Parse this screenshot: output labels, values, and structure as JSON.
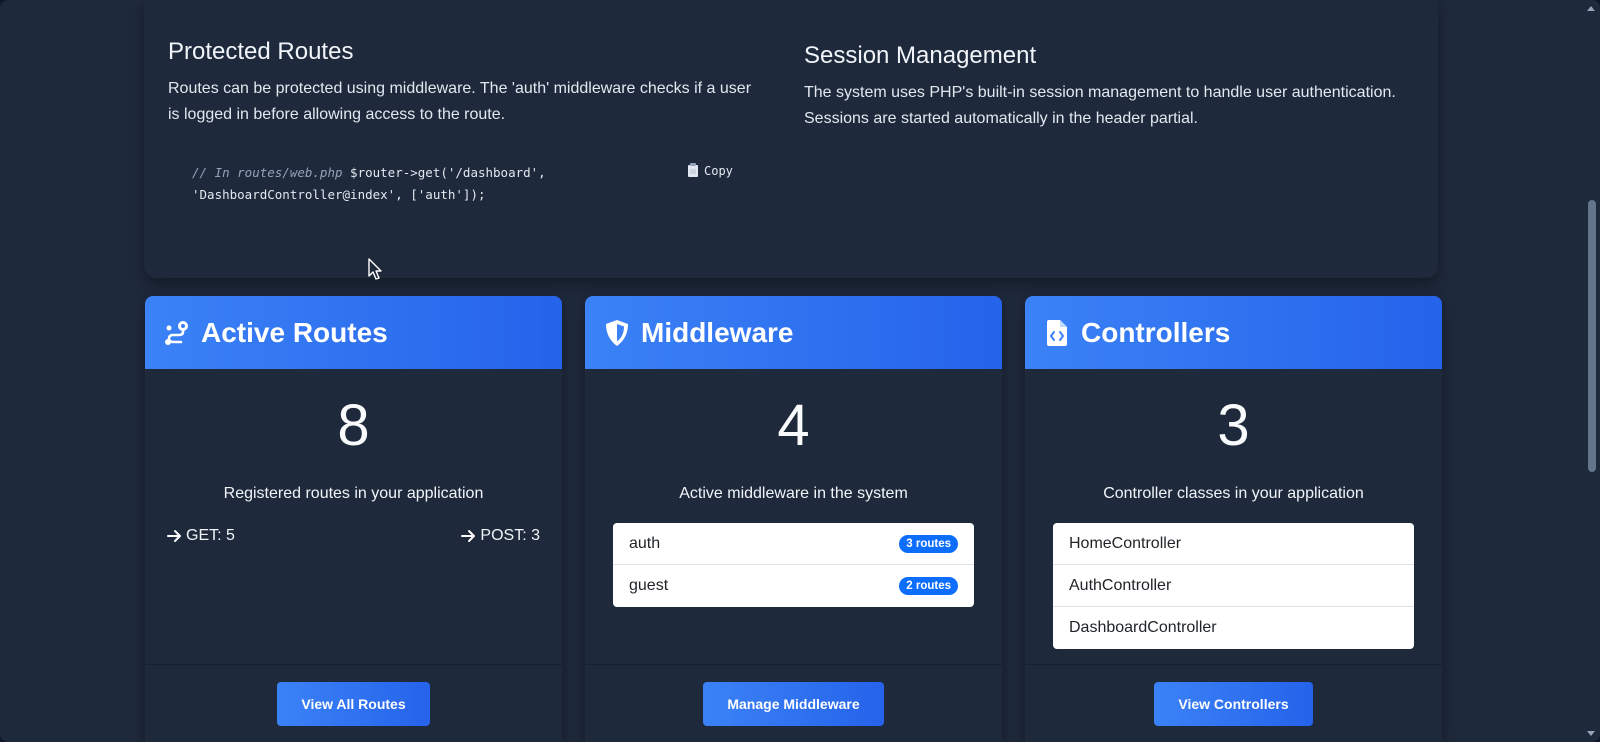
{
  "info": {
    "protected": {
      "title": "Protected Routes",
      "text": "Routes can be protected using middleware. The 'auth' middleware checks if a user is logged in before allowing access to the route.",
      "code_comment": "// In routes/web.php",
      "code_rest": " $router->get('/dashboard', 'DashboardController@index', ['auth']);",
      "copy_label": "Copy"
    },
    "session": {
      "title": "Session Management",
      "text": "The system uses PHP's built-in session management to handle user authentication. Sessions are started automatically in the header partial."
    }
  },
  "cards": {
    "routes": {
      "title": "Active Routes",
      "count": "8",
      "desc": "Registered routes in your application",
      "get_label": "GET: 5",
      "post_label": "POST: 3",
      "button": "View All Routes"
    },
    "middleware": {
      "title": "Middleware",
      "count": "4",
      "desc": "Active middleware in the system",
      "items": [
        {
          "name": "auth",
          "badge": "3 routes"
        },
        {
          "name": "guest",
          "badge": "2 routes"
        }
      ],
      "button": "Manage Middleware"
    },
    "controllers": {
      "title": "Controllers",
      "count": "3",
      "desc": "Controller classes in your application",
      "items": [
        "HomeController",
        "AuthController",
        "DashboardController"
      ],
      "button": "View Controllers"
    }
  },
  "colors": {
    "accent": "#3b82f6",
    "badge": "#0d6efd",
    "background": "#1e293b"
  }
}
